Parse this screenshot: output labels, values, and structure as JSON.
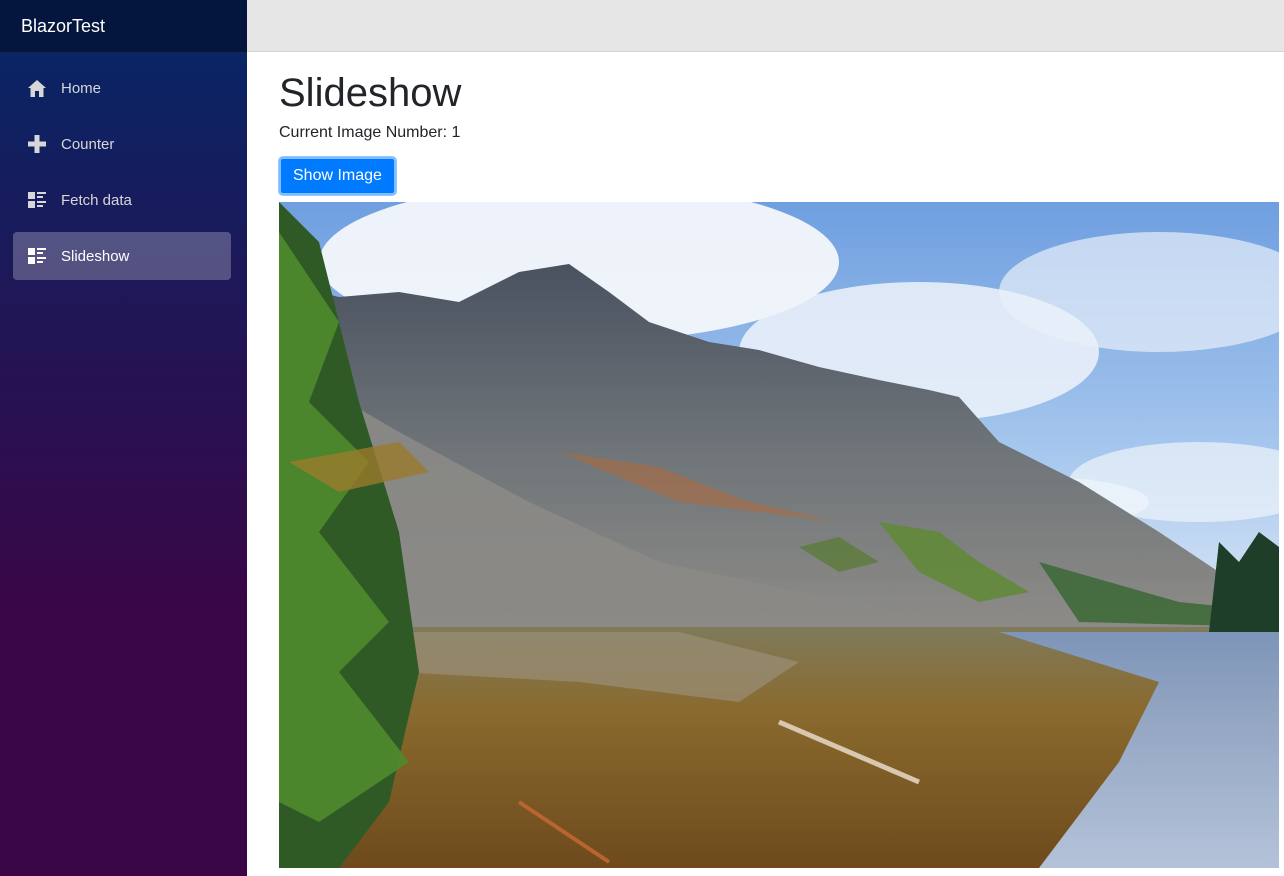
{
  "app": {
    "brand": "BlazorTest"
  },
  "sidebar": {
    "items": [
      {
        "label": "Home",
        "icon": "home-icon",
        "active": false
      },
      {
        "label": "Counter",
        "icon": "plus-icon",
        "active": false
      },
      {
        "label": "Fetch data",
        "icon": "list-rich-icon",
        "active": false
      },
      {
        "label": "Slideshow",
        "icon": "list-rich-icon",
        "active": true
      }
    ]
  },
  "main": {
    "title": "Slideshow",
    "current_label": "Current Image Number: 1",
    "show_button": "Show Image",
    "image": {
      "subject": "mountain-lake-photo"
    }
  },
  "colors": {
    "sidebar_top": "#052767",
    "sidebar_bottom": "#3a0647",
    "top_row": "#e6e6e6",
    "button": "#007bff"
  }
}
